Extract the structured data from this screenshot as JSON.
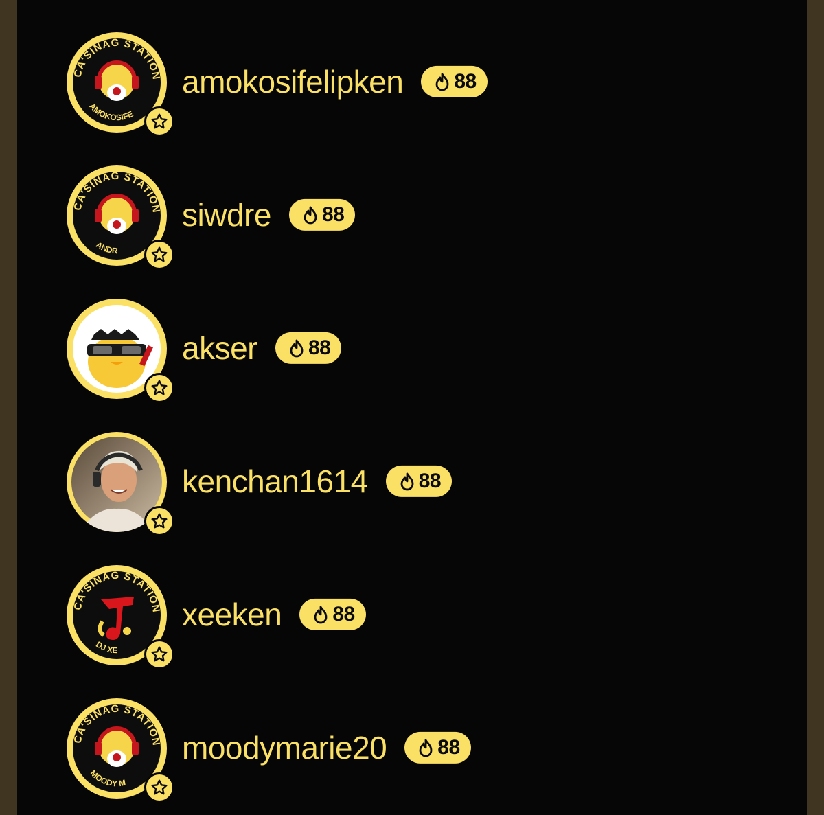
{
  "colors": {
    "accent": "#fbe066",
    "panel_background": "#060606",
    "outer_background": "#3f3521",
    "badge_text": "#0a0a0a"
  },
  "icons": {
    "badge_icon": "flame-icon",
    "avatar_badge_icon": "star-icon"
  },
  "listeners": [
    {
      "username": "amokosifelipken",
      "streak": "88",
      "avatar_style": "station-logo",
      "avatar_ring_text": "CA'SINAG STATIONHEAD",
      "avatar_bottom_text": "AMOKOSIFE"
    },
    {
      "username": "siwdre",
      "streak": "88",
      "avatar_style": "station-logo",
      "avatar_ring_text": "CA'SINAG STATIONHEAD",
      "avatar_bottom_text": "ANDR"
    },
    {
      "username": "akser",
      "streak": "88",
      "avatar_style": "cartoon-chick",
      "avatar_ring_text": "",
      "avatar_bottom_text": ""
    },
    {
      "username": "kenchan1614",
      "streak": "88",
      "avatar_style": "photo",
      "avatar_ring_text": "",
      "avatar_bottom_text": ""
    },
    {
      "username": "xeeken",
      "streak": "88",
      "avatar_style": "music-note-logo",
      "avatar_ring_text": "CA'SINAG STATIONHEAD",
      "avatar_bottom_text": "DJ XE"
    },
    {
      "username": "moodymarie20",
      "streak": "88",
      "avatar_style": "station-logo",
      "avatar_ring_text": "CA'SINAG STATIONHEAD",
      "avatar_bottom_text": "MOODY M"
    }
  ]
}
